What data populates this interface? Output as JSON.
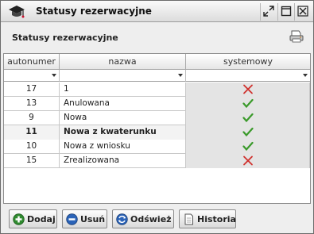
{
  "window": {
    "title": "Statusy rezerwacyjne"
  },
  "panel": {
    "title": "Statusy rezerwacyjne"
  },
  "table": {
    "columns": [
      "autonumer",
      "nazwa",
      "systemowy"
    ],
    "rows": [
      {
        "id": "17",
        "name": "1",
        "system": false,
        "bold": false
      },
      {
        "id": "13",
        "name": "Anulowana",
        "system": true,
        "bold": false
      },
      {
        "id": "9",
        "name": "Nowa",
        "system": true,
        "bold": false
      },
      {
        "id": "11",
        "name": "Nowa z kwaterunku",
        "system": true,
        "bold": true
      },
      {
        "id": "10",
        "name": "Nowa z wniosku",
        "system": true,
        "bold": false
      },
      {
        "id": "15",
        "name": "Zrealizowana",
        "system": false,
        "bold": false
      }
    ]
  },
  "buttons": {
    "add": "Dodaj",
    "remove": "Usuń",
    "refresh": "Odśwież",
    "history": "Historia"
  },
  "colors": {
    "check": "#3a9a2a",
    "cross": "#d0312d",
    "add": "#2f8a2f",
    "remove": "#2a63b8"
  }
}
